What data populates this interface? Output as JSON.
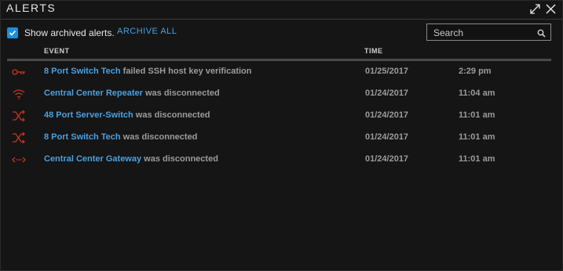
{
  "window": {
    "title": "ALERTS",
    "icons": [
      "expand-icon",
      "close-icon"
    ]
  },
  "toolbar": {
    "show_archived_label": "Show archived alerts.",
    "show_archived_checked": true,
    "archive_all_label": "ARCHIVE ALL",
    "search_placeholder": "Search",
    "search_value": ""
  },
  "table": {
    "columns": [
      "EVENT",
      "TIME"
    ],
    "rows": [
      {
        "icon": "key-icon",
        "device": "8 Port Switch Tech",
        "message": " failed SSH host key verification",
        "date": "01/25/2017",
        "time": "2:29 pm"
      },
      {
        "icon": "wifi-icon",
        "device": "Central Center Repeater",
        "message": " was disconnected",
        "date": "01/24/2017",
        "time": "11:04 am"
      },
      {
        "icon": "switch-icon",
        "device": "48 Port Server-Switch",
        "message": " was disconnected",
        "date": "01/24/2017",
        "time": "11:01 am"
      },
      {
        "icon": "switch-icon",
        "device": "8 Port Switch Tech",
        "message": " was disconnected",
        "date": "01/24/2017",
        "time": "11:01 am"
      },
      {
        "icon": "gateway-icon",
        "device": "Central Center Gateway",
        "message": " was disconnected",
        "date": "01/24/2017",
        "time": "11:01 am"
      }
    ]
  },
  "colors": {
    "accent": "#4aa0e0",
    "checkbox": "#1a8fe0",
    "alert_icon": "#c8361e",
    "text_muted": "#9b9b9b"
  }
}
